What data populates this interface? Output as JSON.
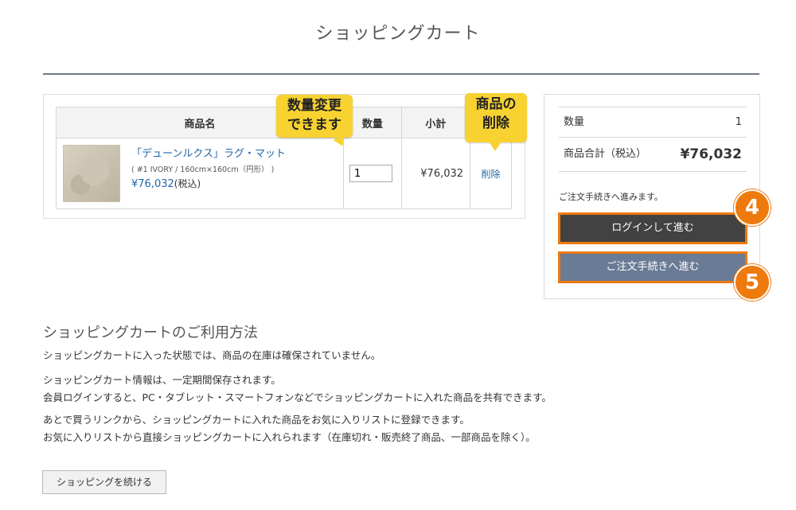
{
  "page": {
    "title": "ショッピングカート"
  },
  "cart": {
    "headers": {
      "name": "商品名",
      "qty": "数量",
      "subtotal": "小計"
    },
    "item": {
      "name": "「デューンルクス」ラグ・マット",
      "option": "( #1 IVORY / 160cm×160cm（円形） )",
      "price": "¥76,032",
      "tax_note": "(税込)",
      "qty": "1",
      "subtotal": "¥76,032",
      "delete_label": "削除"
    }
  },
  "callouts": {
    "qty": [
      "数量変更",
      "できます"
    ],
    "delete": [
      "商品の",
      "削除"
    ]
  },
  "summary": {
    "qty_label": "数量",
    "qty_value": "1",
    "total_label": "商品合計（税込）",
    "total_value": "¥76,032",
    "note": "ご注文手続きへ進みます。",
    "login_button": "ログインして進む",
    "checkout_button": "ご注文手続きへ進む",
    "badge_login": "4",
    "badge_checkout": "5"
  },
  "usage": {
    "title": "ショッピングカートのご利用方法",
    "p1": "ショッピングカートに入った状態では、商品の在庫は確保されていません。",
    "p2a": "ショッピングカート情報は、一定期間保存されます。",
    "p2b": "会員ログインすると、PC・タブレット・スマートフォンなどでショッピングカートに入れた商品を共有できます。",
    "p3a": "あとで買うリンクから、ショッピングカートに入れた商品をお気に入りリストに登録できます。",
    "p3b": "お気に入りリストから直接ショッピングカートに入れられます（在庫切れ・販売終了商品、一部商品を除く）。"
  },
  "continue_button": "ショッピングを続ける",
  "colors": {
    "accent_orange": "#ee7a0e",
    "callout_yellow": "#f7d231",
    "link_blue": "#1f66a8",
    "login_bg": "#424242",
    "checkout_bg": "#6a7b96"
  }
}
